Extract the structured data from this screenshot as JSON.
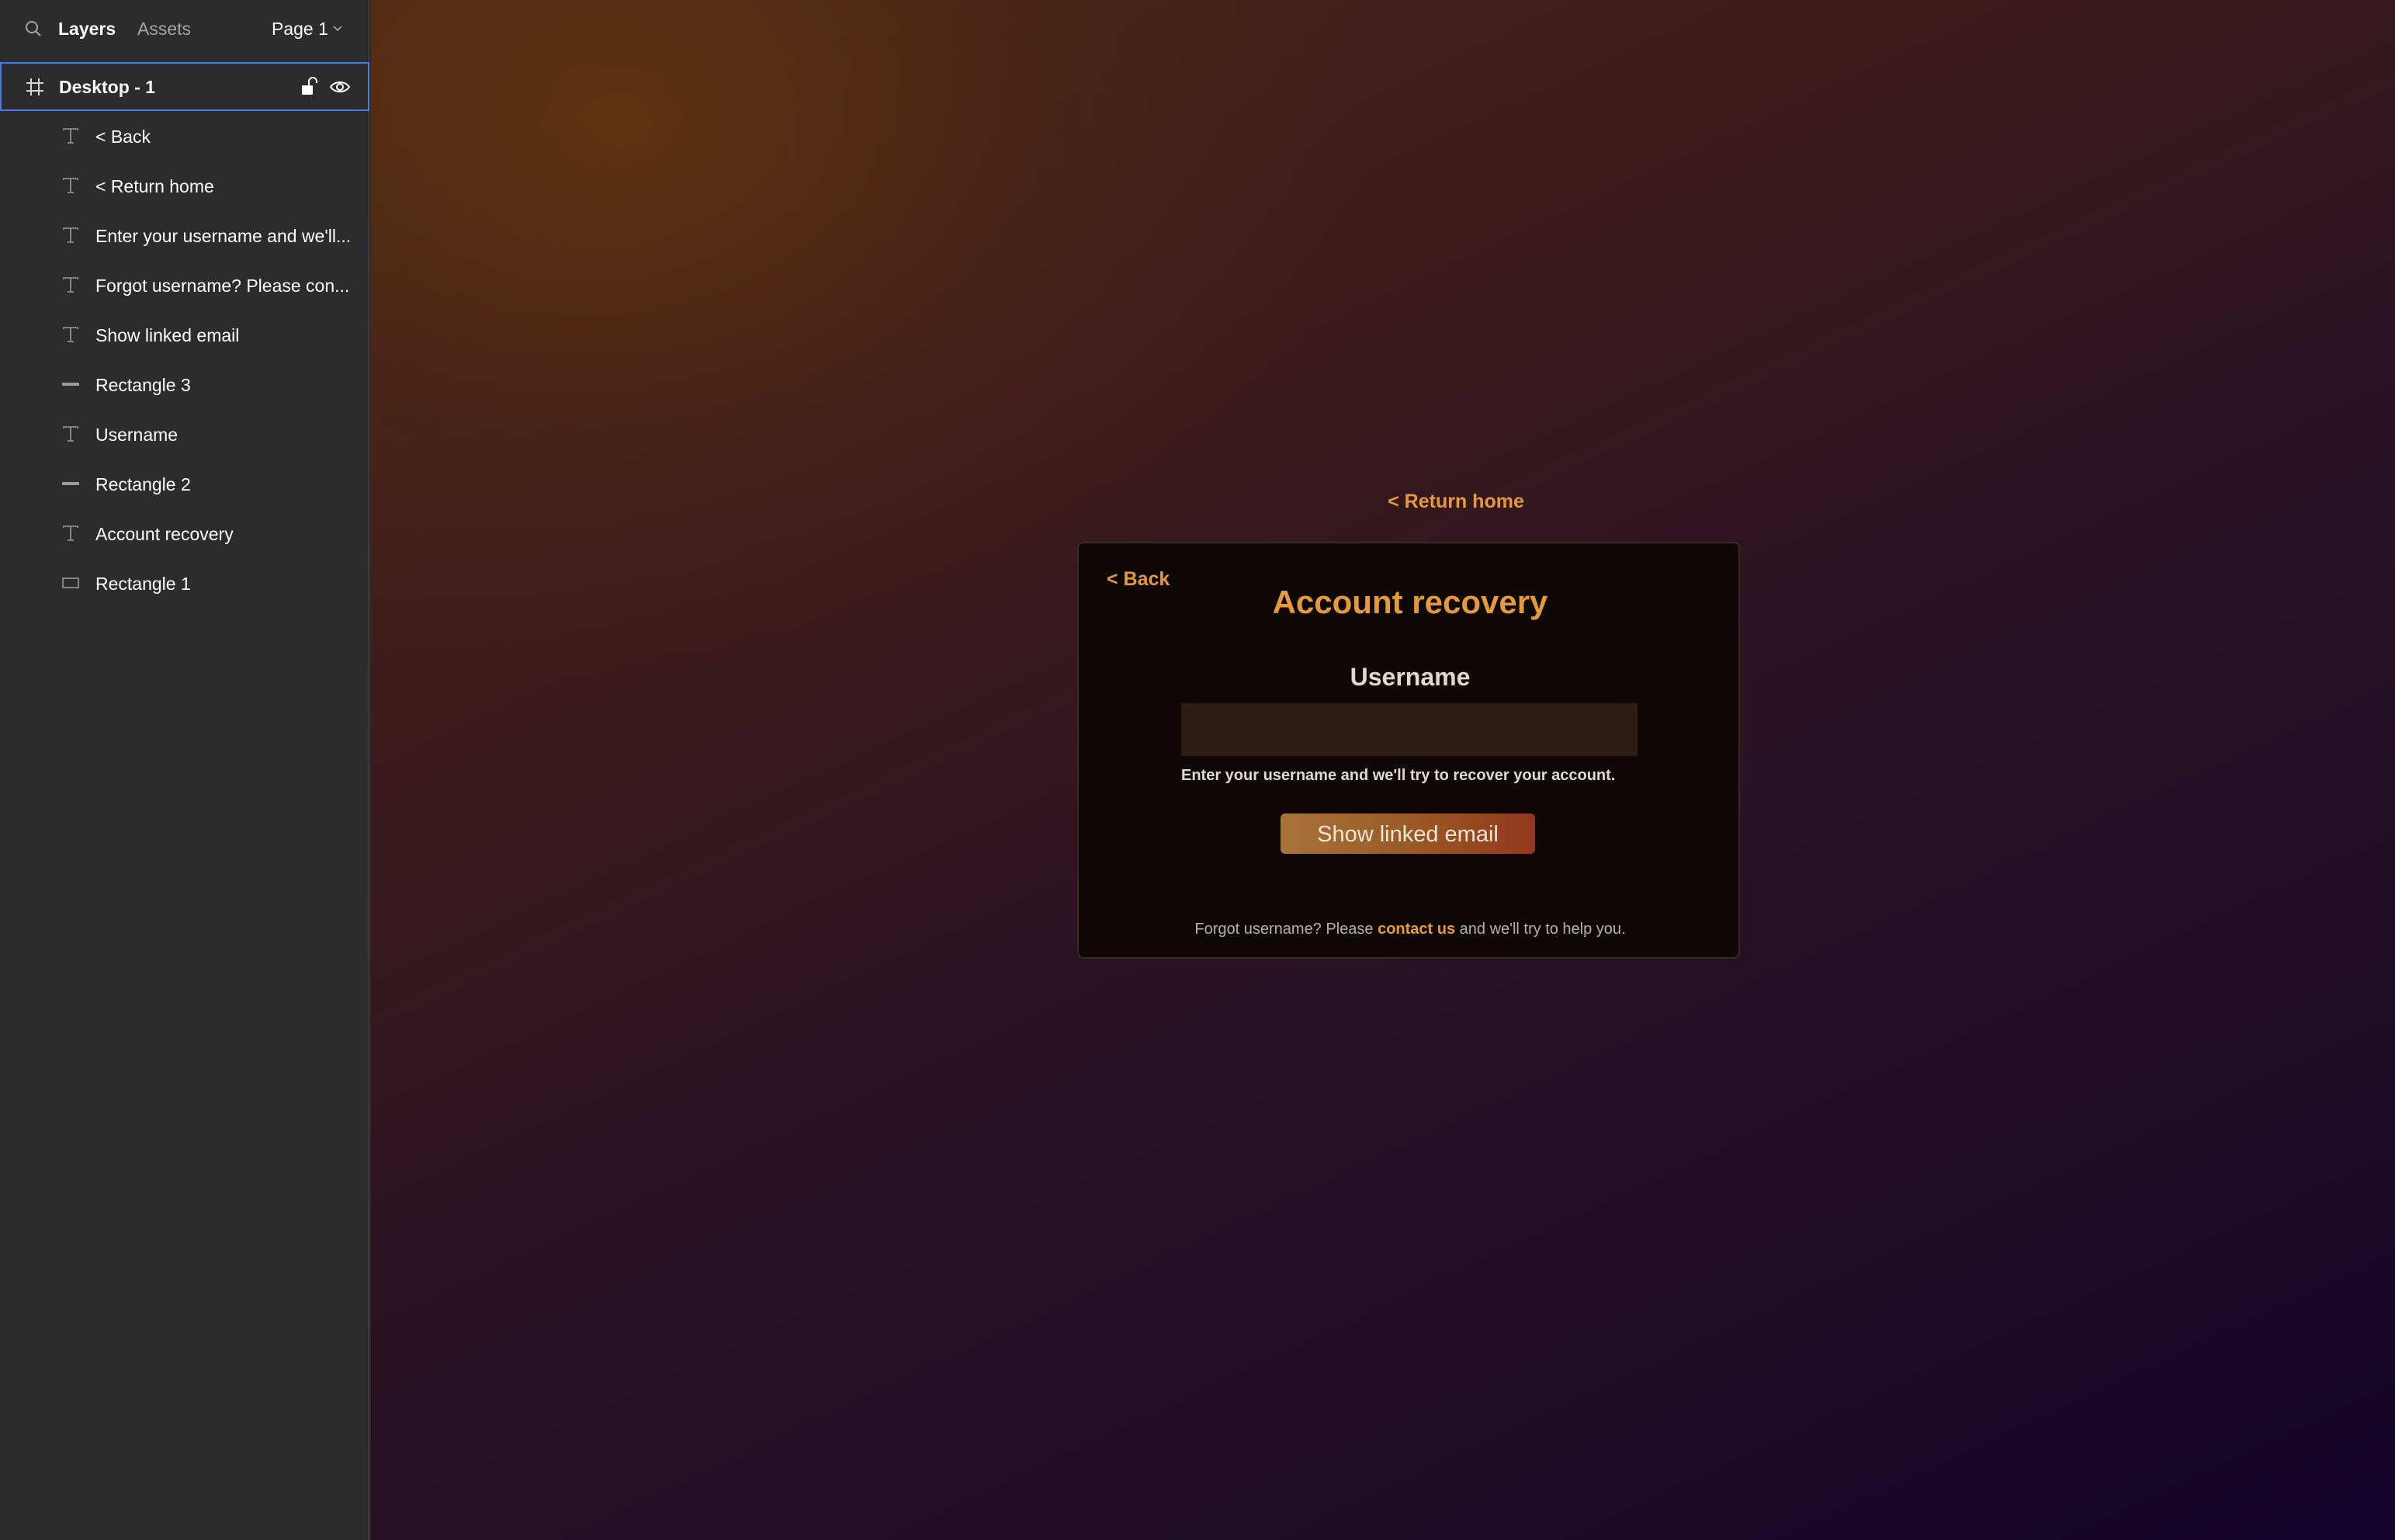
{
  "sidebar": {
    "tabs": {
      "layers": "Layers",
      "assets": "Assets"
    },
    "page_selector": "Page 1",
    "frame": {
      "label": "Desktop - 1"
    },
    "layers": [
      {
        "label": "< Back",
        "type": "text"
      },
      {
        "label": "< Return home",
        "type": "text"
      },
      {
        "label": "Enter your username and we'll...",
        "type": "text"
      },
      {
        "label": "Forgot username? Please con...",
        "type": "text"
      },
      {
        "label": "Show linked email",
        "type": "text"
      },
      {
        "label": "Rectangle 3",
        "type": "line"
      },
      {
        "label": "Username",
        "type": "text"
      },
      {
        "label": "Rectangle 2",
        "type": "line"
      },
      {
        "label": "Account recovery",
        "type": "text"
      },
      {
        "label": "Rectangle 1",
        "type": "rect"
      }
    ]
  },
  "canvas": {
    "return_link": "< Return home",
    "card": {
      "back_link": "< Back",
      "title": "Account recovery",
      "field_label": "Username",
      "input_value": "",
      "hint": "Enter your username and we'll try to recover your account.",
      "button_label": "Show linked email",
      "footer_before": "Forgot username? Please ",
      "footer_link": "contact us",
      "footer_after": " and we'll try to help you."
    }
  },
  "colors": {
    "accent": "#e49a3a",
    "card_bg": "#0e0906",
    "input_bg": "#2b1d13",
    "selection": "#4c7bd6"
  }
}
